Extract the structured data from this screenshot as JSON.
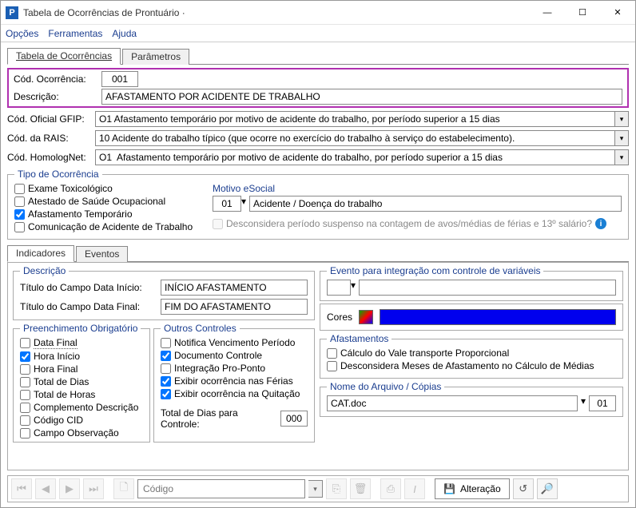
{
  "window": {
    "title": "Tabela de Ocorrências de Prontuário ·",
    "app_icon_letter": "P",
    "min": "—",
    "max": "☐",
    "close": "✕"
  },
  "menu": {
    "opcoes": "Opções",
    "ferramentas": "Ferramentas",
    "ajuda": "Ajuda"
  },
  "tabs_main": {
    "tab1": "Tabela de Ocorrências",
    "tab2": "Parâmetros"
  },
  "fields": {
    "cod_ocorrencia_label": "Cód. Ocorrência:",
    "cod_ocorrencia_value": "001",
    "descricao_label": "Descrição:",
    "descricao_value": "AFASTAMENTO POR ACIDENTE DE TRABALHO",
    "cod_gfip_label": "Cód. Oficial GFIP:",
    "cod_gfip_value": "O1 Afastamento temporário por motivo de acidente do trabalho, por período superior a 15 dias",
    "cod_rais_label": "Cód. da RAIS:",
    "cod_rais_value": "10 Acidente do trabalho típico (que ocorre no exercício do trabalho à serviço do estabelecimento).",
    "cod_homolog_label": "Cód. HomologNet:",
    "cod_homolog_value": "O1  Afastamento temporário por motivo de acidente do trabalho, por período superior a 15 dias"
  },
  "tipo": {
    "legend": "Tipo de Ocorrência",
    "exame": "Exame Toxicológico",
    "atestado": "Atestado de Saúde Ocupacional",
    "afast": "Afastamento Temporário",
    "cat": "Comunicação de Acidente de Trabalho",
    "motivo_label": "Motivo eSocial",
    "motivo_code": "01",
    "motivo_desc": "Acidente / Doença do trabalho",
    "desconsidera": "Desconsidera período suspenso na contagem de avos/médias de férias e 13º salário?"
  },
  "subtabs": {
    "ind": "Indicadores",
    "ev": "Eventos"
  },
  "desc_group": {
    "legend": "Descrição",
    "data_inicio_label": "Título do Campo Data Início:",
    "data_inicio_value": "INÍCIO AFASTAMENTO",
    "data_final_label": "Título do Campo Data Final:",
    "data_final_value": "FIM DO AFASTAMENTO"
  },
  "preench": {
    "legend": "Preenchimento Obrigatório",
    "data_final": "Data Final",
    "hora_inicio": "Hora Início",
    "hora_final": "Hora Final",
    "total_dias": "Total de Dias",
    "total_horas": "Total de Horas",
    "compl_desc": "Complemento Descrição",
    "codigo_cid": "Código CID",
    "campo_obs": "Campo Observação"
  },
  "outros": {
    "legend": "Outros Controles",
    "notifica": "Notifica Vencimento Período",
    "doc_controle": "Documento Controle",
    "integra": "Integração Pro-Ponto",
    "exib_ferias": "Exibir ocorrência nas Férias",
    "exib_quit": "Exibir ocorrência na Quitação",
    "total_dias_ctrl_label": "Total de Dias para Controle:",
    "total_dias_ctrl_value": "000"
  },
  "evento_integ": {
    "legend": "Evento para integração com controle de variáveis",
    "value": ""
  },
  "cores": {
    "label": "Cores",
    "color": "#0000ee"
  },
  "afast": {
    "legend": "Afastamentos",
    "calc_vale": "Cálculo do Vale transporte Proporcional",
    "desc_meses": "Desconsidera Meses de Afastamento no Cálculo de Médias"
  },
  "arquivo": {
    "legend": "Nome do Arquivo / Cópias",
    "nome": "CAT.doc",
    "copias": "01"
  },
  "toolbar": {
    "search_placeholder": "Código",
    "mode": "Alteração"
  }
}
